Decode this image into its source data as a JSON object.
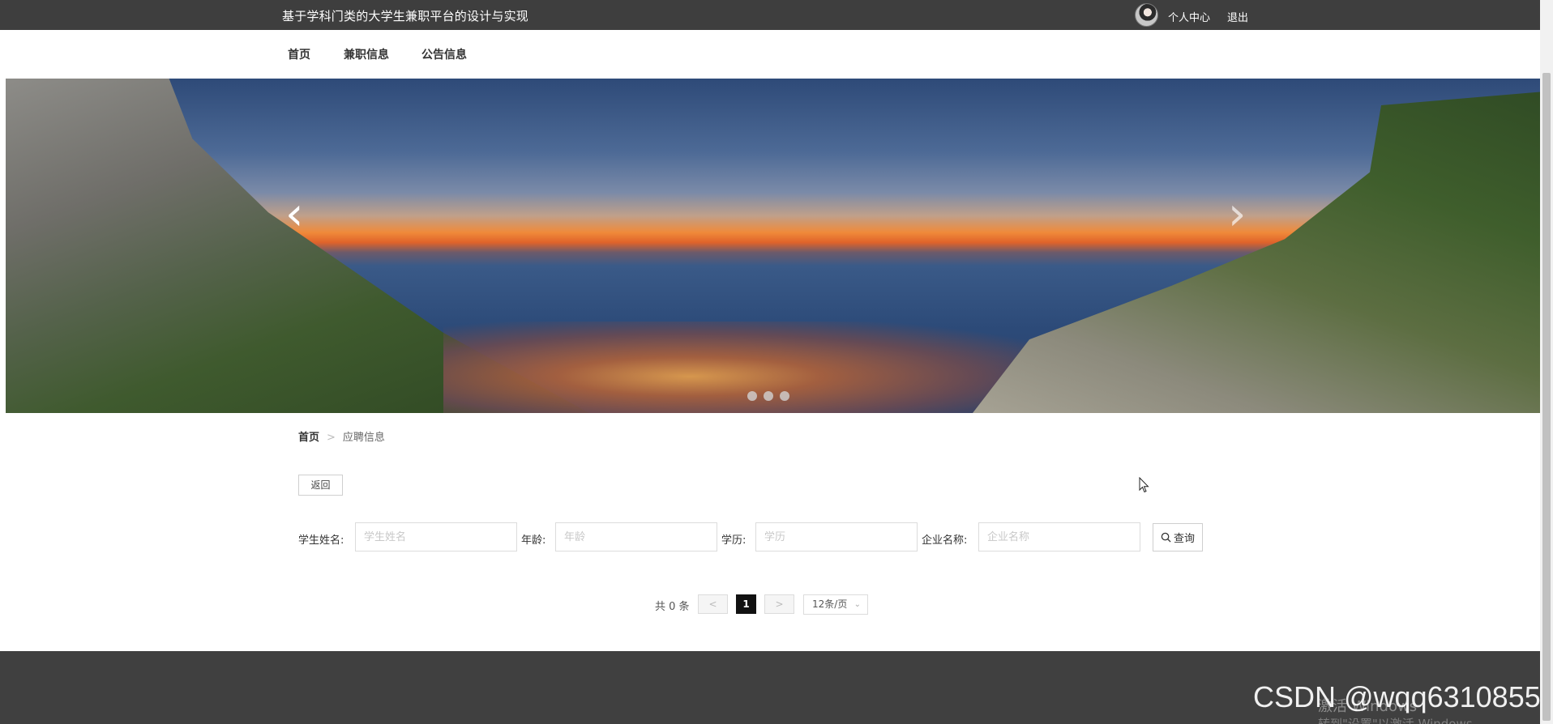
{
  "topbar": {
    "title": "基于学科门类的大学生兼职平台的设计与实现",
    "user_center": "个人中心",
    "logout": "退出"
  },
  "nav": {
    "items": [
      {
        "label": "首页"
      },
      {
        "label": "兼职信息"
      },
      {
        "label": "公告信息"
      }
    ]
  },
  "banner": {
    "prev_arrow": "‹",
    "next_arrow": "›",
    "slide_count": 3
  },
  "breadcrumb": {
    "home": "首页",
    "separator": ">",
    "current": "应聘信息"
  },
  "back_button": "返回",
  "search": {
    "student_name": {
      "label": "学生姓名:",
      "placeholder": "学生姓名",
      "value": ""
    },
    "age": {
      "label": "年龄:",
      "placeholder": "年龄",
      "value": ""
    },
    "education": {
      "label": "学历:",
      "placeholder": "学历",
      "value": ""
    },
    "company_name": {
      "label": "企业名称:",
      "placeholder": "企业名称",
      "value": ""
    },
    "query_button": "查询"
  },
  "pagination": {
    "total_text": "共 0 条",
    "prev": "<",
    "next": ">",
    "current_page": "1",
    "page_size": "12条/页"
  },
  "footer": {
    "activation_title": "激活 Windows",
    "activation_sub": "转到\"设置\"以激活 Windows。"
  },
  "watermark": "CSDN @wqq6310855",
  "colors": {
    "topbar": "#3e3e3e",
    "footer": "#404040",
    "page_active": "#111111"
  }
}
